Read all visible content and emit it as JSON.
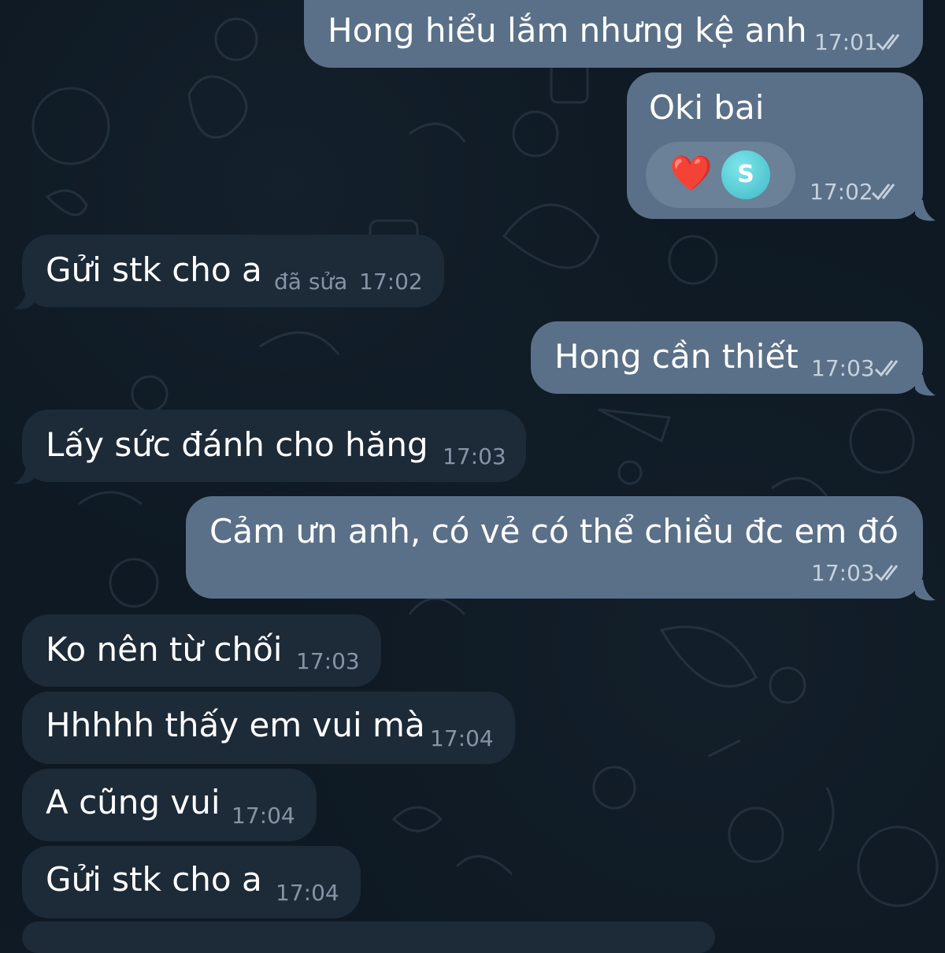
{
  "messages": [
    {
      "direction": "out",
      "text": "Hong hiểu lắm nhưng kệ anh",
      "time": "17:01"
    },
    {
      "direction": "out",
      "text": "Oki bai",
      "time": "17:02",
      "reaction": {
        "emoji": "❤️",
        "avatar_letter": "S"
      }
    },
    {
      "direction": "in",
      "text": "Gửi stk cho a",
      "edited_label": "đã sửa",
      "time": "17:02"
    },
    {
      "direction": "out",
      "text": "Hong cần thiết",
      "time": "17:03"
    },
    {
      "direction": "in",
      "text": "Lấy sức đánh cho hăng",
      "time": "17:03"
    },
    {
      "direction": "out",
      "text": "Cảm ưn anh, có vẻ có thể chiều đc em đó",
      "time": "17:03"
    },
    {
      "direction": "in",
      "text": "Ko nên từ chối",
      "time": "17:03"
    },
    {
      "direction": "in",
      "text": "Hhhhh thấy em vui mà",
      "time": "17:04"
    },
    {
      "direction": "in",
      "text": "A cũng vui",
      "time": "17:04"
    },
    {
      "direction": "in",
      "text": "Gửi stk cho a",
      "time": "17:04"
    }
  ],
  "icons": {
    "read_receipt": "double-check-icon",
    "reaction_avatar": "avatar"
  },
  "colors": {
    "background": "#0e1923",
    "outgoing_bubble": "#5a7088",
    "incoming_bubble": "#1d2a38",
    "heart": "#e0262b",
    "avatar": "#4cc4d0"
  }
}
